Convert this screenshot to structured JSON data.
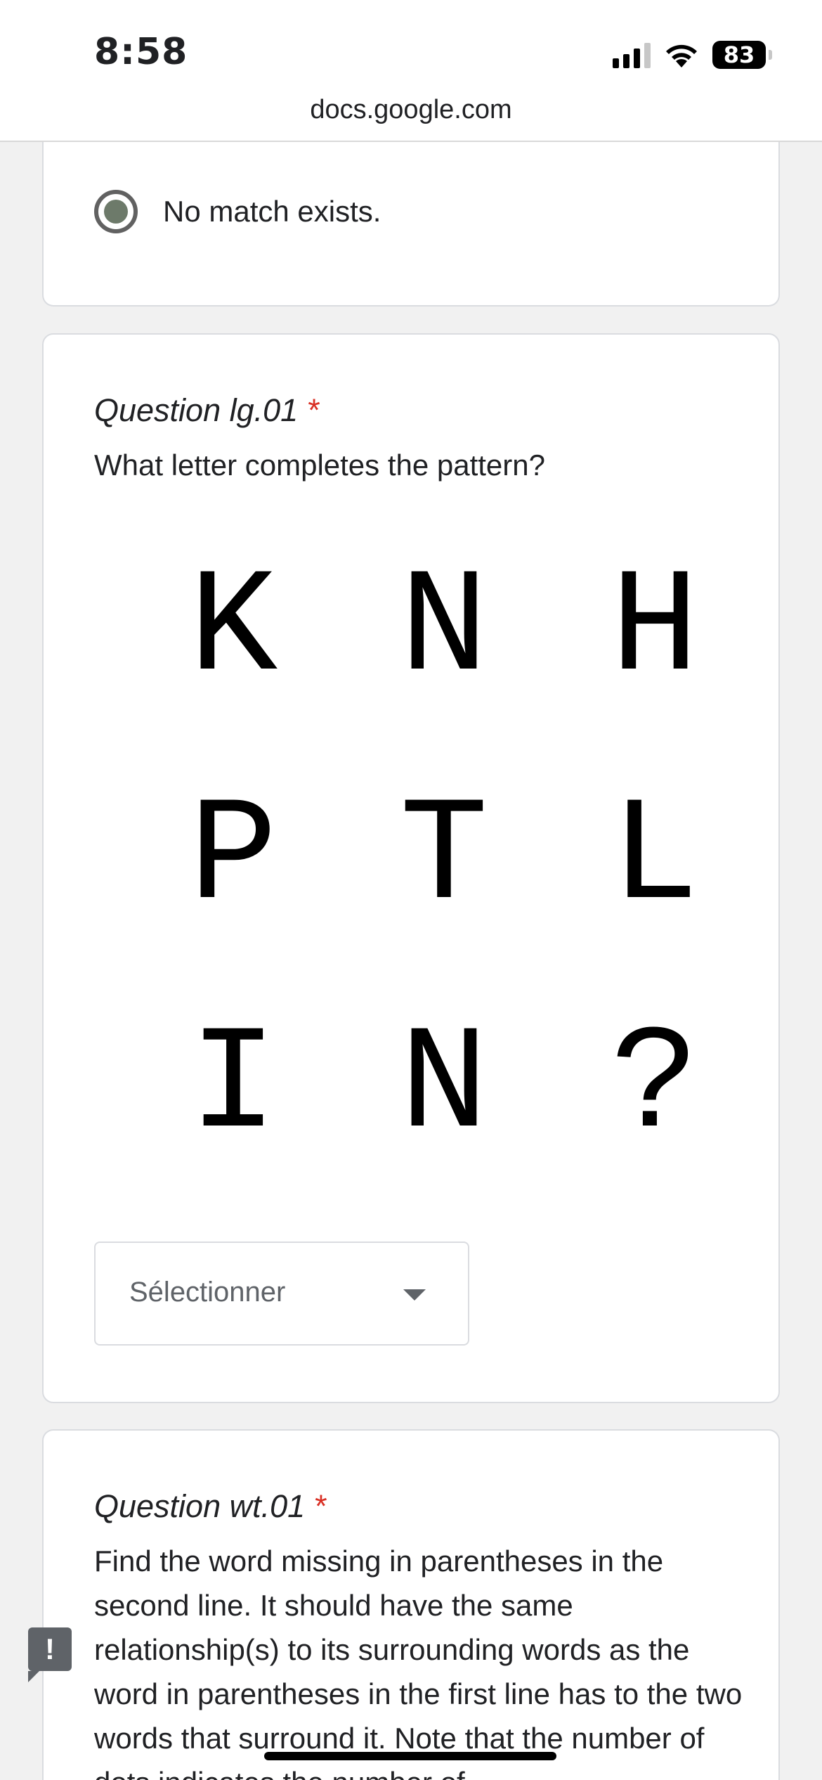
{
  "status_bar": {
    "time": "8:58",
    "battery": "83",
    "url": "docs.google.com"
  },
  "previous_question": {
    "selected_option": "No match exists."
  },
  "question_lg": {
    "title": "Question lg.01",
    "required_marker": "*",
    "prompt": "What letter completes the pattern?",
    "grid": [
      [
        "K",
        "N",
        "H"
      ],
      [
        "P",
        "T",
        "L"
      ],
      [
        "I",
        "N",
        "?"
      ]
    ],
    "dropdown_placeholder": "Sélectionner"
  },
  "question_wt": {
    "title": "Question wt.01",
    "required_marker": "*",
    "prompt": "Find the word missing in parentheses in the second line. It should have the same relationship(s) to its surrounding words as the word in parentheses in the first line has to the two words that surround it. Note that the number of dots indicates the number of"
  },
  "icons": {
    "report": "report-problem-icon",
    "wifi": "wifi-icon",
    "signal": "cellular-signal-icon",
    "battery": "battery-icon"
  },
  "colors": {
    "required": "#d93025",
    "radio_selected": "#6d7a6a"
  }
}
